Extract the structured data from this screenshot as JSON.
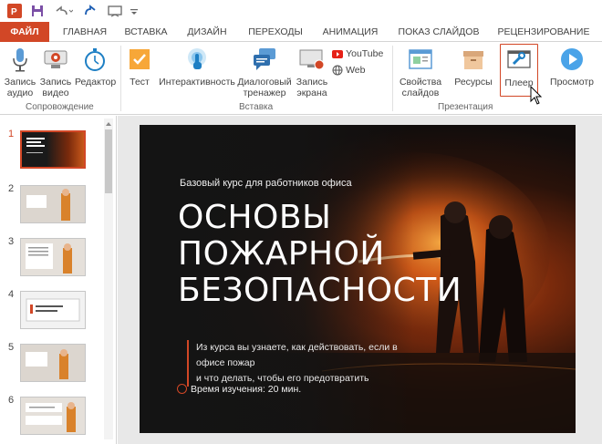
{
  "tabs": {
    "file": "ФАЙЛ",
    "home": "ГЛАВНАЯ",
    "insert": "ВСТАВКА",
    "design": "ДИЗАЙН",
    "transitions": "ПЕРЕХОДЫ",
    "animation": "АНИМАЦИЯ",
    "slideshow": "ПОКАЗ СЛАЙДОВ",
    "review": "РЕЦЕНЗИРОВАНИЕ"
  },
  "ribbon": {
    "record_audio": [
      "Запись",
      "аудио"
    ],
    "record_video": [
      "Запись",
      "видео"
    ],
    "editor": "Редактор",
    "group_accompaniment": "Сопровождение",
    "test": "Тест",
    "interactivity": "Интерактивность",
    "dialog_trainer": [
      "Диалоговый",
      "тренажер"
    ],
    "screen_record": [
      "Запись",
      "экрана"
    ],
    "youtube": "YouTube",
    "web": "Web",
    "group_insert": "Вставка",
    "slide_properties": [
      "Свойства",
      "слайдов"
    ],
    "resources": "Ресурсы",
    "player": "Плеер",
    "preview": "Просмотр",
    "group_presentation": "Презентация"
  },
  "thumbnails": {
    "numbers": [
      "1",
      "2",
      "3",
      "4",
      "5",
      "6"
    ],
    "selected": "1"
  },
  "slide": {
    "subtitle": "Базовый курс для работников офиса",
    "title": [
      "ОСНОВЫ",
      "ПОЖАРНОЙ",
      "БЕЗОПАСНОСТИ"
    ],
    "description": [
      "Из курса вы узнаете, как действовать, если в офисе пожар",
      "и что делать, чтобы его предотвратить"
    ],
    "time": "Время изучения: 20 мин."
  },
  "colors": {
    "accent": "#d24726",
    "tab_text": "#444444",
    "ribbon_bg": "#ffffff"
  }
}
